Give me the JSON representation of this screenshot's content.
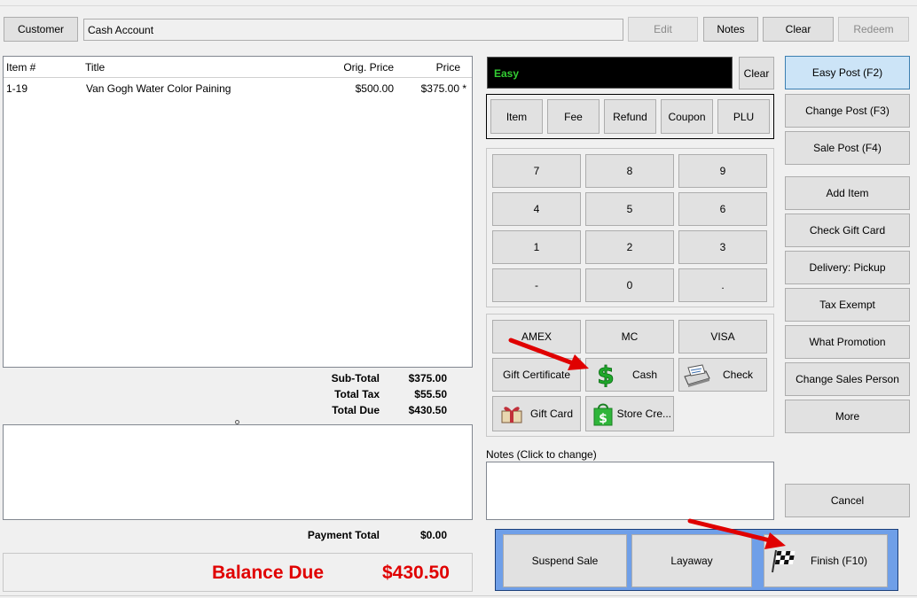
{
  "header": {
    "customer_button": "Customer",
    "customer_value": "Cash Account",
    "edit_button": "Edit",
    "notes_button": "Notes",
    "clear_button": "Clear",
    "redeem_button": "Redeem"
  },
  "items_table": {
    "columns": [
      "Item #",
      "Title",
      "Orig. Price",
      "Price"
    ],
    "rows": [
      {
        "item": "1-19",
        "title": "Van Gogh Water Color Paining",
        "orig_price": "$500.00",
        "price": "$375.00 *"
      }
    ]
  },
  "totals": {
    "subtotal_label": "Sub-Total",
    "subtotal_value": "$375.00",
    "tax_label": "Total Tax",
    "tax_value": "$55.50",
    "due_label": "Total Due",
    "due_value": "$430.50",
    "payment_label": "Payment Total",
    "payment_value": "$0.00",
    "balance_label": "Balance Due",
    "balance_value": "$430.50"
  },
  "entry": {
    "mode_text": "Easy",
    "clear_button": "Clear",
    "type_buttons": [
      "Item",
      "Fee",
      "Refund",
      "Coupon",
      "PLU"
    ]
  },
  "keypad": [
    "7",
    "8",
    "9",
    "4",
    "5",
    "6",
    "1",
    "2",
    "3",
    "-",
    "0",
    "."
  ],
  "tenders": {
    "amex": "AMEX",
    "mc": "MC",
    "visa": "VISA",
    "gift_certificate": "Gift Certificate",
    "cash": "Cash",
    "check": "Check",
    "gift_card": "Gift Card",
    "store_credit": "Store Cre..."
  },
  "notes_label": "Notes (Click to change)",
  "side_buttons": {
    "easy_post": "Easy Post (F2)",
    "change_post": "Change Post (F3)",
    "sale_post": "Sale Post (F4)",
    "add_item": "Add Item",
    "check_gift_card": "Check Gift Card",
    "delivery": "Delivery: Pickup",
    "tax_exempt": "Tax Exempt",
    "what_promotion": "What Promotion",
    "change_sales_person": "Change Sales Person",
    "more": "More",
    "cancel": "Cancel"
  },
  "bottom_buttons": {
    "suspend_sale": "Suspend Sale",
    "layaway": "Layaway",
    "finish": "Finish (F10)"
  },
  "colors": {
    "accent_red": "#e00000",
    "easy_green": "#33cc33",
    "bottom_panel": "#6f9fe8",
    "active_button": "#cce4f7"
  }
}
